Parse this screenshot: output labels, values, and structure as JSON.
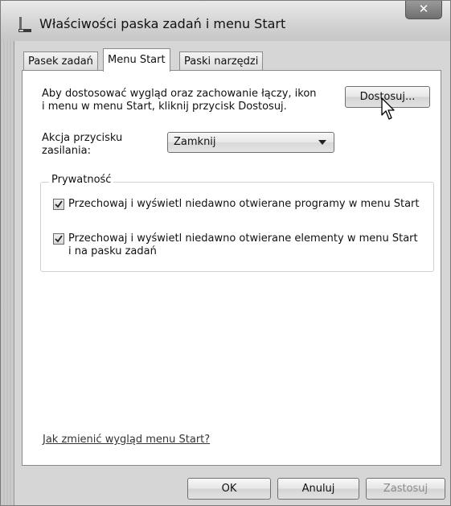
{
  "window": {
    "title": "Właściwości paska zadań i menu Start",
    "close_glyph": "✕",
    "icon": "taskbar-properties-icon"
  },
  "tabs": [
    {
      "label": "Pasek zadań",
      "active": false
    },
    {
      "label": "Menu Start",
      "active": true
    },
    {
      "label": "Paski narzędzi",
      "active": false
    }
  ],
  "customize": {
    "description_line1": "Aby dostosować wygląd oraz zachowanie łączy, ikon",
    "description_line2": "i menu w menu Start, kliknij przycisk Dostosuj.",
    "button_label": "Dostosuj..."
  },
  "power_button": {
    "label_line1": "Akcja przycisku",
    "label_line2": "zasilania:",
    "selected": "Zamknij"
  },
  "privacy": {
    "group_label": "Prywatność",
    "option1": {
      "checked": true,
      "text": "Przechowaj i wyświetl niedawno otwierane programy w menu Start"
    },
    "option2": {
      "checked": true,
      "text_line1": "Przechowaj i wyświetl niedawno otwierane elementy w menu Start",
      "text_line2": "i na pasku zadań"
    }
  },
  "help_link": "Jak zmienić wygląd menu Start?",
  "footer": {
    "ok": "OK",
    "cancel": "Anuluj",
    "apply": "Zastosuj",
    "apply_enabled": false
  }
}
